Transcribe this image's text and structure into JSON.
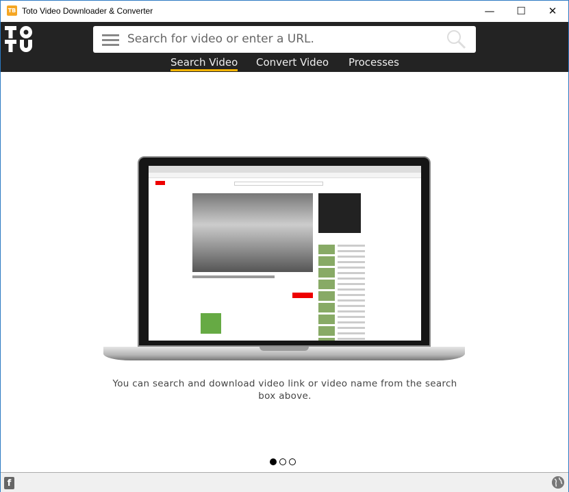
{
  "window": {
    "title": "Toto Video Downloader & Converter",
    "app_icon": "TB",
    "minimize": "—",
    "maximize": "☐",
    "close": "✕"
  },
  "header": {
    "logo": "TOTO",
    "search_placeholder": "Search for video or enter a URL.",
    "tabs": [
      {
        "label": "Search Video",
        "active": true
      },
      {
        "label": "Convert Video",
        "active": false
      },
      {
        "label": "Processes",
        "active": false
      }
    ],
    "accent": "#f5b400"
  },
  "slide": {
    "message": "You can search and download video link or video name from the search box above.",
    "current": 1,
    "total": 3
  },
  "footer": {
    "facebook": "f",
    "icons": [
      "facebook-icon",
      "globe-icon"
    ]
  }
}
